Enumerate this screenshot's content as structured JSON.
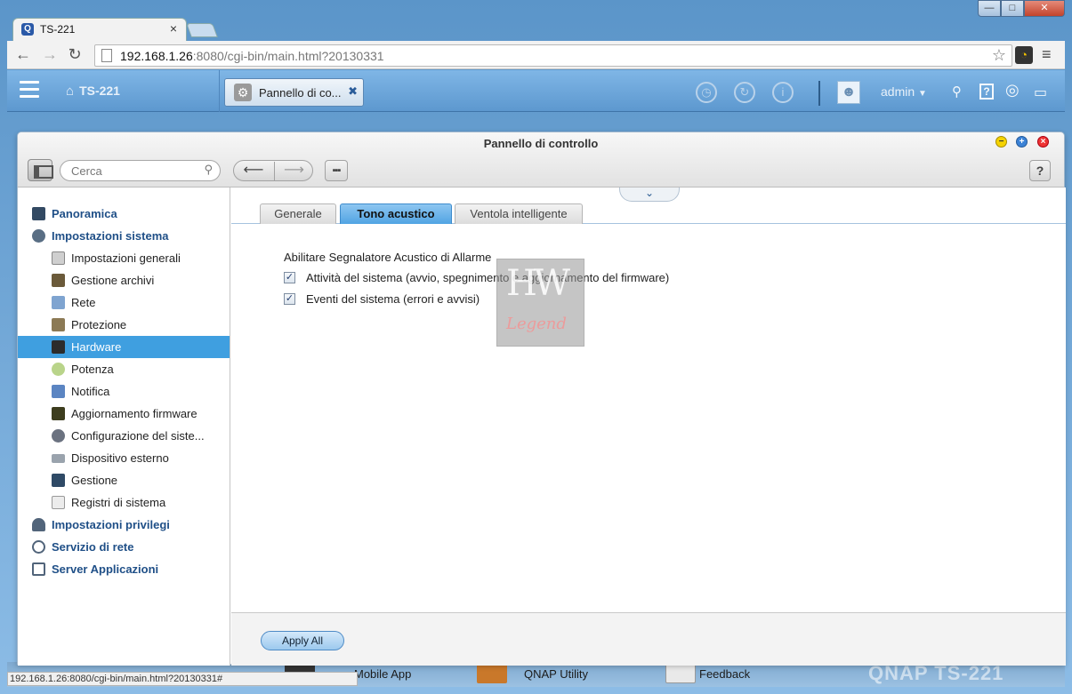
{
  "browser": {
    "tab_title": "TS-221",
    "url_host": "192.168.1.26",
    "url_rest": ":8080/cgi-bin/main.html?20130331",
    "status_url": "192.168.1.26:8080/cgi-bin/main.html?20130331#"
  },
  "qnap_bar": {
    "home_label": "TS-221",
    "app_tab_label": "Pannello di co...",
    "user": "admin"
  },
  "desktop": {
    "items": [
      "Mobile App",
      "QNAP Utility",
      "Feedback"
    ],
    "faded_text": "QNAP TS-221"
  },
  "control_panel": {
    "title": "Pannello di controllo",
    "search_placeholder": "Cerca",
    "help_label": "?"
  },
  "sidebar": {
    "top_items": [
      {
        "label": "Panoramica",
        "icon": "grid-icon"
      },
      {
        "label": "Impostazioni sistema",
        "icon": "gear-icon"
      },
      {
        "label": "Impostazioni privilegi",
        "icon": "user-icon"
      },
      {
        "label": "Servizio di rete",
        "icon": "globe-icon"
      },
      {
        "label": "Server Applicazioni",
        "icon": "tray-icon"
      }
    ],
    "sub_items": [
      {
        "label": "Impostazioni generali",
        "icon": "settings-doc-icon"
      },
      {
        "label": "Gestione archivi",
        "icon": "database-icon"
      },
      {
        "label": "Rete",
        "icon": "network-icon"
      },
      {
        "label": "Protezione",
        "icon": "lock-icon"
      },
      {
        "label": "Hardware",
        "icon": "hardware-icon"
      },
      {
        "label": "Potenza",
        "icon": "bulb-icon"
      },
      {
        "label": "Notifica",
        "icon": "notify-icon"
      },
      {
        "label": "Aggiornamento firmware",
        "icon": "firmware-icon"
      },
      {
        "label": "Configurazione del siste...",
        "icon": "config-icon"
      },
      {
        "label": "Dispositivo esterno",
        "icon": "drive-icon"
      },
      {
        "label": "Gestione",
        "icon": "monitor-icon"
      },
      {
        "label": "Registri di sistema",
        "icon": "log-icon"
      }
    ],
    "selected": "Hardware"
  },
  "tabs": [
    {
      "label": "Generale"
    },
    {
      "label": "Tono acustico"
    },
    {
      "label": "Ventola intelligente"
    }
  ],
  "active_tab": "Tono acustico",
  "content": {
    "section_title": "Abilitare Segnalatore Acustico di Allarme",
    "checkboxes": [
      {
        "label": "Attività del sistema (avvio, spegnimento e aggiornamento del firmware)",
        "checked": true
      },
      {
        "label": "Eventi del sistema (errori e avvisi)",
        "checked": true
      }
    ],
    "watermark_hw": "HW",
    "watermark_legend": "Legend",
    "apply_label": "Apply All"
  },
  "colors": {
    "accent": "#3f9fe0",
    "sidebar_heading": "#1f4f87",
    "qnap_bar": "#6aa7d8"
  }
}
